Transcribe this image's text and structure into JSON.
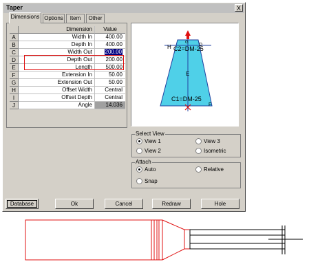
{
  "window": {
    "title": "Taper",
    "close_glyph": "X"
  },
  "tabs": [
    {
      "label": "Dimensions",
      "active": true
    },
    {
      "label": "Options",
      "active": false
    },
    {
      "label": "Item",
      "active": false
    },
    {
      "label": "Other",
      "active": false
    }
  ],
  "table": {
    "headers": {
      "dimension": "Dimension",
      "value": "Value"
    },
    "rows": [
      {
        "key": "A",
        "dimension": "Width In",
        "value": "400.00"
      },
      {
        "key": "B",
        "dimension": "Depth In",
        "value": "400.00"
      },
      {
        "key": "C",
        "dimension": "Width Out",
        "value": "200.00"
      },
      {
        "key": "D",
        "dimension": "Depth Out",
        "value": "200.00"
      },
      {
        "key": "E",
        "dimension": "Length",
        "value": "500.00"
      },
      {
        "key": "F",
        "dimension": "Extension In",
        "value": "50.00"
      },
      {
        "key": "G",
        "dimension": "Extension Out",
        "value": "50.00"
      },
      {
        "key": "H",
        "dimension": "Offset Width",
        "value": "Central"
      },
      {
        "key": "I",
        "dimension": "Offset Depth",
        "value": "Central"
      },
      {
        "key": "J",
        "dimension": "Angle",
        "value": "14.036"
      }
    ]
  },
  "preview": {
    "labels": {
      "top": "C2=DM-25",
      "left": "H",
      "top_small": "G",
      "right_small": "D",
      "middle": "E",
      "bottom": "C1=DM-25",
      "bottom_right": "F"
    },
    "colors": {
      "fill": "#4fd0e8",
      "outline": "#2040a0",
      "marker": "#e01010"
    }
  },
  "select_view": {
    "label": "Select View",
    "options": [
      {
        "label": "View 1",
        "selected": true
      },
      {
        "label": "View 3",
        "selected": false
      },
      {
        "label": "View 2",
        "selected": false
      },
      {
        "label": "Isometric",
        "selected": false
      }
    ]
  },
  "attach": {
    "label": "Attach",
    "options": [
      {
        "label": "Auto",
        "selected": true
      },
      {
        "label": "Relative",
        "selected": false
      },
      {
        "label": "Snap",
        "selected": false
      }
    ]
  },
  "buttons": {
    "database": "Database",
    "ok": "Ok",
    "cancel": "Cancel",
    "redraw": "Redraw",
    "hole": "Hole"
  },
  "colors": {
    "dialog_bg": "#d4d0c8",
    "highlight_box": "#e01010",
    "selection": "#000080",
    "drawing_red": "#e01010"
  }
}
